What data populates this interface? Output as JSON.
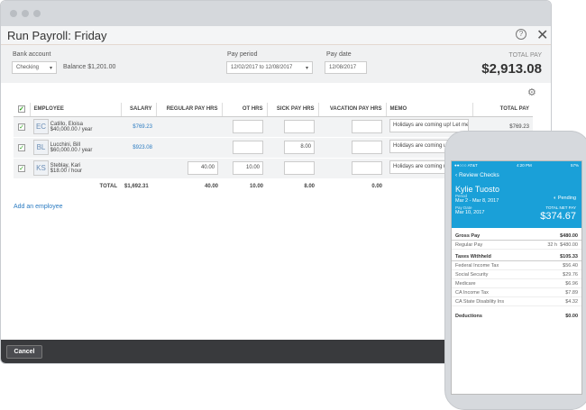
{
  "window": {
    "title": "Run Payroll: Friday",
    "help_icon": "?",
    "close_icon": "✕"
  },
  "form": {
    "bank_label": "Bank account",
    "bank_value": "Checking",
    "balance": "Balance $1,201.00",
    "period_label": "Pay period",
    "period_value": "12/02/2017 to 12/08/2017",
    "date_label": "Pay date",
    "date_value": "12/08/2017",
    "total_label": "TOTAL PAY",
    "total_value": "$2,913.08"
  },
  "table": {
    "headers": [
      "EMPLOYEE",
      "SALARY",
      "REGULAR PAY HRS",
      "OT HRS",
      "SICK PAY HRS",
      "VACATION PAY HRS",
      "MEMO",
      "TOTAL PAY"
    ],
    "rows": [
      {
        "initials": "EC",
        "name": "Catillo, Eloisa",
        "rate": "$40,000.00 / year",
        "salary": "$769.23",
        "regular": "",
        "ot": "",
        "sick": "",
        "vacation": "",
        "memo": "Holidays are coming up! Let me kno",
        "total": "$769.23"
      },
      {
        "initials": "BL",
        "name": "Lucchini, Bill",
        "rate": "$60,000.00 / year",
        "salary": "$923.08",
        "regular": "",
        "ot": "",
        "sick": "8.00",
        "vacation": "",
        "memo": "Holidays are coming up",
        "total": ""
      },
      {
        "initials": "KS",
        "name": "Steblay, Kari",
        "rate": "$18.00 / hour",
        "salary": "",
        "regular": "40.00",
        "ot": "10.00",
        "sick": "",
        "vacation": "",
        "memo": "Holidays are coming up",
        "total": ""
      }
    ],
    "totals": {
      "label": "TOTAL",
      "salary": "$1,692.31",
      "regular": "40.00",
      "ot": "10.00",
      "sick": "8.00",
      "vacation": "0.00"
    }
  },
  "add_employee": "Add an employee",
  "footer": {
    "cancel": "Cancel"
  },
  "phone": {
    "carrier": "●●○○○ AT&T",
    "time": "4:20 PM",
    "battery": "57%",
    "back": "Review Checks",
    "name": "Kylie Tuosto",
    "period_label": "Period",
    "period": "Mar 2 - Mar 8, 2017",
    "paydate_label": "Pay Date",
    "paydate": "Mar 10, 2017",
    "status": "Pending",
    "net_label": "TOTAL NET PAY",
    "net": "$374.67",
    "gross_label": "Gross Pay",
    "gross": "$480.00",
    "regular_label": "Regular Pay",
    "regular_hrs": "32 h",
    "regular": "$480.00",
    "taxes_label": "Taxes Withheld",
    "taxes": "$105.33",
    "tax_items": [
      {
        "label": "Federal Income Tax",
        "value": "$56.40"
      },
      {
        "label": "Social Security",
        "value": "$29.76"
      },
      {
        "label": "Medicare",
        "value": "$6.96"
      },
      {
        "label": "CA Income Tax",
        "value": "$7.89"
      },
      {
        "label": "CA State Disability Ins",
        "value": "$4.32"
      }
    ],
    "deductions_label": "Deductions",
    "deductions": "$0.00"
  }
}
